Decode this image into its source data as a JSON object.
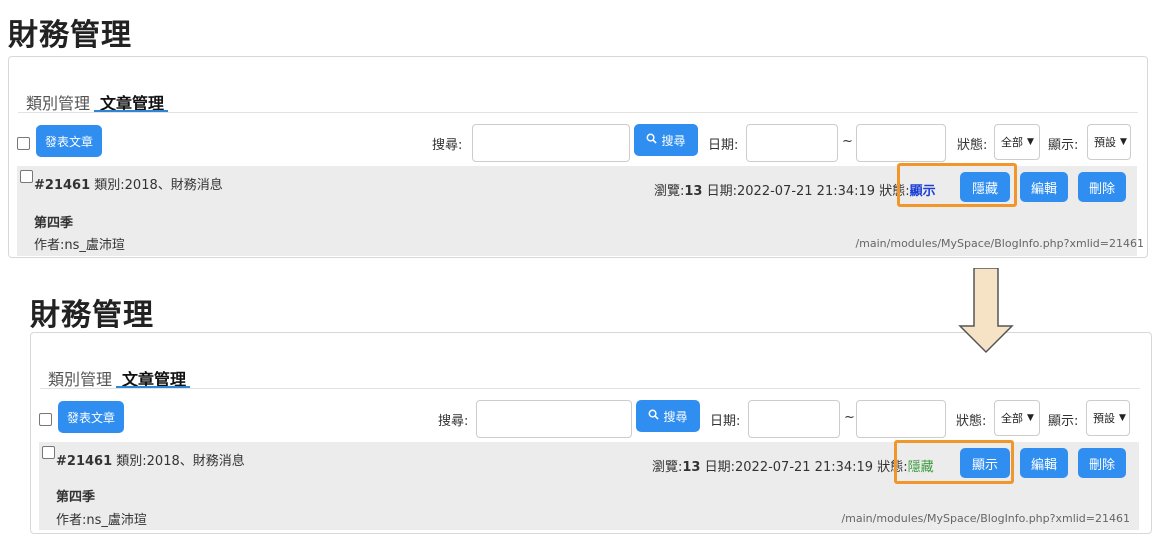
{
  "panels": [
    {
      "title": "財務管理",
      "tabs": {
        "category": "類別管理",
        "articles": "文章管理"
      },
      "toolbar": {
        "post_button": "發表文章",
        "search_label": "搜尋:",
        "search_button": "搜尋",
        "date_label": "日期:",
        "date_separator": "~",
        "status_label": "狀態:",
        "status_value": "全部",
        "display_label": "顯示:",
        "display_value": "預設"
      },
      "row": {
        "id": "#21461",
        "category": "類別:2018、財務消息",
        "views_label": "瀏覽:",
        "views": "13",
        "date": "日期:2022-07-21 21:34:19",
        "status_label": "狀態:",
        "status_value": "顯示",
        "toggle_button": "隱藏",
        "edit_button": "編輯",
        "delete_button": "刪除",
        "article_title": "第四季",
        "author": "作者:ns_盧沛瑄",
        "path": "/main/modules/MySpace/BlogInfo.php?xmlid=21461"
      }
    },
    {
      "title": "財務管理",
      "tabs": {
        "category": "類別管理",
        "articles": "文章管理"
      },
      "toolbar": {
        "post_button": "發表文章",
        "search_label": "搜尋:",
        "search_button": "搜尋",
        "date_label": "日期:",
        "date_separator": "~",
        "status_label": "狀態:",
        "status_value": "全部",
        "display_label": "顯示:",
        "display_value": "預設"
      },
      "row": {
        "id": "#21461",
        "category": "類別:2018、財務消息",
        "views_label": "瀏覽:",
        "views": "13",
        "date": "日期:2022-07-21 21:34:19",
        "status_label": "狀態:",
        "status_value": "隱藏",
        "toggle_button": "顯示",
        "edit_button": "編輯",
        "delete_button": "刪除",
        "article_title": "第四季",
        "author": "作者:ns_盧沛瑄",
        "path": "/main/modules/MySpace/BlogInfo.php?xmlid=21461"
      }
    }
  ],
  "colors": {
    "accent": "#2f8ef0",
    "highlight": "#f0962a",
    "arrow_fill": "#f6e3c6",
    "status_shown": "#1c3fd6",
    "status_hidden": "#3a9a3a"
  }
}
